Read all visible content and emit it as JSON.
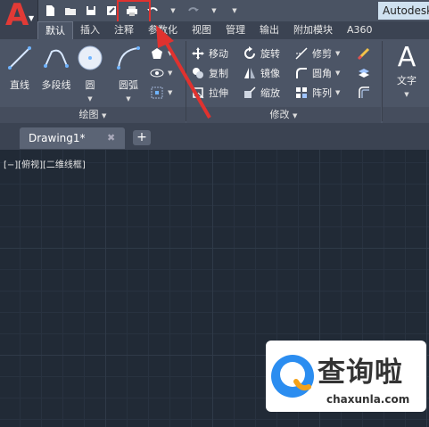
{
  "app": {
    "title": "Autodesk"
  },
  "tabs": [
    "默认",
    "插入",
    "注释",
    "参数化",
    "视图",
    "管理",
    "输出",
    "附加模块",
    "A360"
  ],
  "draw_panel": {
    "label": "绘图",
    "tools": [
      "直线",
      "多段线",
      "圆",
      "圆弧"
    ]
  },
  "modify_panel": {
    "label": "修改",
    "rows": [
      [
        "移动",
        "旋转",
        "修剪"
      ],
      [
        "复制",
        "镜像",
        "圆角"
      ],
      [
        "拉伸",
        "缩放",
        "阵列"
      ]
    ]
  },
  "annotation_panel": {
    "text_tool": "文字"
  },
  "document": {
    "tab_title": "Drawing1*",
    "close_glyph": "✖",
    "new_tab_glyph": "+"
  },
  "viewport": {
    "label": "[−][俯视][二维线框]"
  },
  "watermark": {
    "text": "查询啦",
    "url": "chaxunla.com"
  },
  "colors": {
    "highlight": "#e0322f",
    "accent_red": "#e23a36"
  }
}
